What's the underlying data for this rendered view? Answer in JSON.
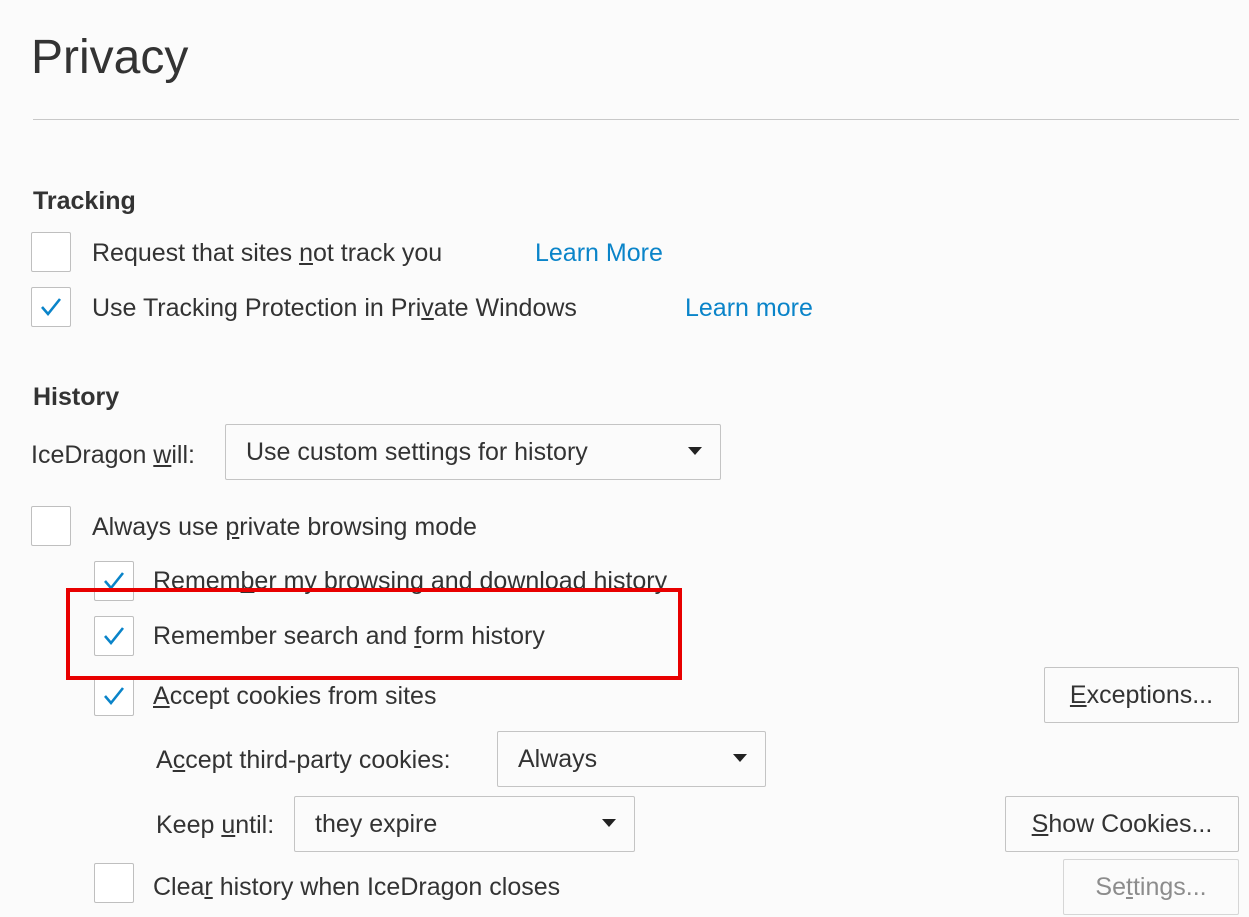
{
  "page": {
    "title": "Privacy"
  },
  "tracking": {
    "heading": "Tracking",
    "dnt": {
      "label_pre": "Request that sites ",
      "label_key": "n",
      "label_post": "ot track you",
      "checked": false,
      "link": "Learn More"
    },
    "protection": {
      "label_pre": "Use Tracking Protection in Pri",
      "label_key": "v",
      "label_post": "ate Windows",
      "checked": true,
      "link": "Learn more"
    }
  },
  "history": {
    "heading": "History",
    "will_label_pre": "IceDragon ",
    "will_label_key": "w",
    "will_label_post": "ill:",
    "mode_value": "Use custom settings for history",
    "private_mode": {
      "label_pre": "Always use ",
      "label_key": "p",
      "label_post": "rivate browsing mode",
      "checked": false
    },
    "browsing": {
      "label_pre": "Remem",
      "label_key": "b",
      "label_post": "er my browsing and download history",
      "checked": true
    },
    "search_form": {
      "label_pre": "Remember search and ",
      "label_key": "f",
      "label_post": "orm history",
      "checked": true
    },
    "cookies": {
      "label_key": "A",
      "label_post": "ccept cookies from sites",
      "checked": true
    },
    "exceptions_pre": "",
    "exceptions_key": "E",
    "exceptions_post": "xceptions...",
    "third_party_pre": "A",
    "third_party_key": "c",
    "third_party_post": "cept third-party cookies:",
    "third_party_value": "Always",
    "keep_pre": "Keep ",
    "keep_key": "u",
    "keep_post": "ntil:",
    "keep_value": "they expire",
    "show_cookies_key": "S",
    "show_cookies_post": "how Cookies...",
    "clear": {
      "label_pre": "Clea",
      "label_key": "r",
      "label_post": " history when IceDragon closes",
      "checked": false
    },
    "settings_pre": "Se",
    "settings_key": "t",
    "settings_post": "tings..."
  },
  "colors": {
    "link": "#0a84c9",
    "check": "#0a84c9",
    "highlight": "#e80000"
  }
}
